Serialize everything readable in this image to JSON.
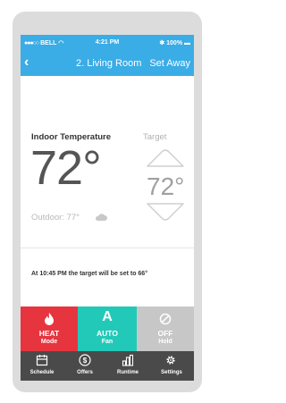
{
  "status_bar": {
    "carrier": "BELL",
    "time": "4:21 PM",
    "battery": "100%"
  },
  "nav": {
    "back": "‹",
    "title": "2. Living Room",
    "action": "Set Away"
  },
  "thermostat": {
    "indoor_label": "Indoor Temperature",
    "indoor_temp": "72°",
    "outdoor_label": "Outdoor: 77°",
    "target_label": "Target",
    "target_temp": "72°"
  },
  "schedule_note": "At 10:45 PM the target will be set to 66°",
  "modes": [
    {
      "glyph": "flame-icon",
      "name": "HEAT",
      "sub": "Mode",
      "color": "#e6353f"
    },
    {
      "glyph": "A",
      "name": "AUTO",
      "sub": "Fan",
      "color": "#23c9b8"
    },
    {
      "glyph": "off-icon",
      "name": "OFF",
      "sub": "Hold",
      "color": "#c7c7c7"
    }
  ],
  "tabs": [
    {
      "label": "Schedule",
      "icon": "calendar-icon"
    },
    {
      "label": "Offers",
      "icon": "dollar-icon"
    },
    {
      "label": "Runtime",
      "icon": "bar-chart-icon"
    },
    {
      "label": "Settings",
      "icon": "gear-icon"
    }
  ],
  "colors": {
    "nav": "#3aace6",
    "tab_bar": "#4a4a4a",
    "phone": "#dcdcdc"
  }
}
